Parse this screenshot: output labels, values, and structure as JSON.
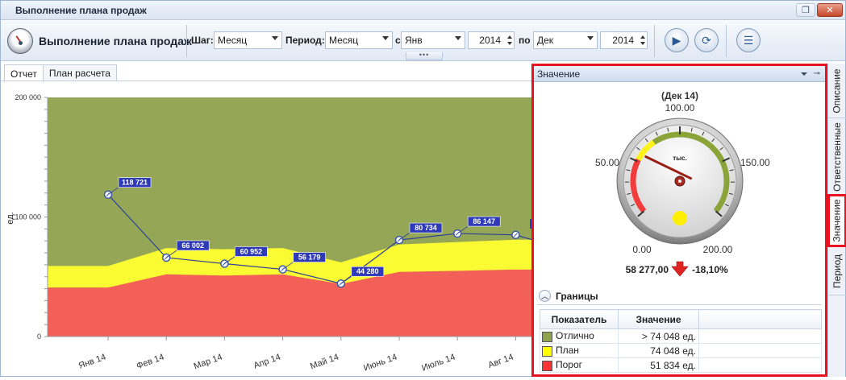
{
  "window": {
    "title": "Выполнение плана продаж"
  },
  "toolbar": {
    "app_title": "Выполнение плана продаж",
    "step_label": "Шаг:",
    "step_value": "Месяц",
    "period_label": "Период:",
    "period_value": "Месяц",
    "from_label": "с",
    "from_month": "Янв",
    "from_year": "2014",
    "to_label": "по",
    "to_month": "Дек",
    "to_year": "2014"
  },
  "tabs": [
    {
      "label": "Отчет",
      "active": true
    },
    {
      "label": "План расчета",
      "active": false
    }
  ],
  "chart_data": {
    "type": "area",
    "title": "",
    "xlabel": "",
    "ylabel": "ед.",
    "ylim": [
      0,
      200000
    ],
    "yticks": [
      "0",
      "100 000",
      "200 000"
    ],
    "categories": [
      "Янв 14",
      "Фев 14",
      "Мар 14",
      "Апр 14",
      "Май 14",
      "Июнь 14",
      "Июль 14",
      "Авг 14"
    ],
    "series": [
      {
        "name": "Отлично",
        "color": "#8fa24d",
        "values": [
          200000,
          200000,
          200000,
          200000,
          200000,
          200000,
          200000,
          200000
        ]
      },
      {
        "name": "План",
        "color": "#ffff32",
        "values": [
          59000,
          74000,
          73000,
          74000,
          62000,
          77000,
          79000,
          81000
        ]
      },
      {
        "name": "Порог",
        "color": "#f2575b",
        "values": [
          41000,
          52000,
          51000,
          52000,
          44000,
          54000,
          55000,
          56000
        ]
      },
      {
        "name": "Значение",
        "color": "#2b3f96",
        "type": "line",
        "values": [
          118721,
          66002,
          60952,
          56179,
          44280,
          80734,
          86147,
          85000
        ],
        "labels": [
          "118 721",
          "66 002",
          "60 952",
          "56 179",
          "44 280",
          "80 734",
          "86 147",
          ""
        ]
      }
    ]
  },
  "panel": {
    "title": "Значение",
    "gauge": {
      "period": "(Дек 14)",
      "unit": "тыс.",
      "min_label": "0.00",
      "max_label": "200.00",
      "q1_label": "50.00",
      "mid_label": "100.00",
      "q3_label": "150.00",
      "value": 58.277,
      "value_text": "58 277,00",
      "delta_text": "-18,10%",
      "ranges": {
        "red_to": 51.834,
        "yellow_to": 74.048
      },
      "status_color": "#ffee00"
    },
    "bounds": {
      "title": "Границы",
      "col_indicator": "Показатель",
      "col_value": "Значение",
      "rows": [
        {
          "name": "Отлично",
          "value": "> 74 048 ед.",
          "color": "#8fa24d"
        },
        {
          "name": "План",
          "value": "74 048 ед.",
          "color": "#ffff00"
        },
        {
          "name": "Порог",
          "value": "51 834 ед.",
          "color": "#ff3333"
        }
      ]
    }
  },
  "side_tabs": [
    "Описание",
    "Ответственные",
    "Значение",
    "Период"
  ]
}
